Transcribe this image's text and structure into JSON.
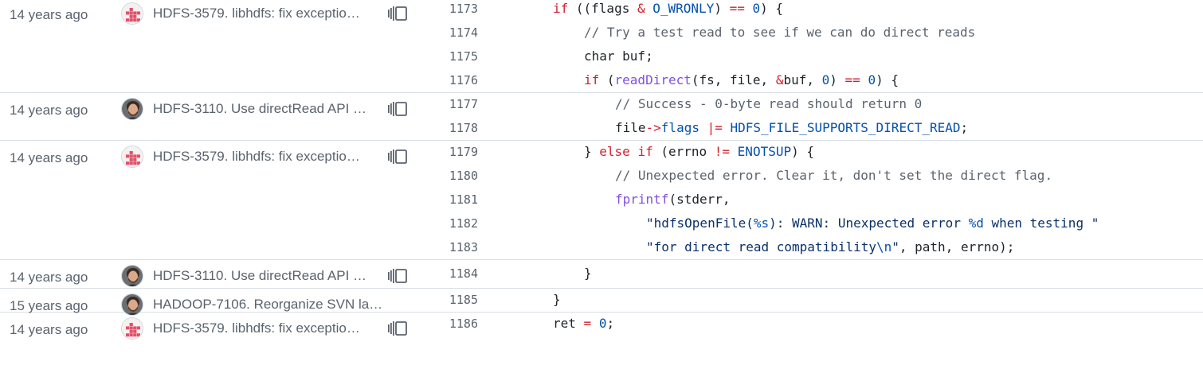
{
  "groups": [
    {
      "age": "14 years ago",
      "avatar": "checker",
      "message": "HDFS-3579. libhdfs: fix exceptio…",
      "reblame": true,
      "lines": [
        {
          "num": "1173",
          "indent": 0,
          "tokens": [
            {
              "t": "if",
              "c": "k"
            },
            {
              "t": " ((flags "
            },
            {
              "t": "&",
              "c": "k"
            },
            {
              "t": " "
            },
            {
              "t": "O_WRONLY",
              "c": "m"
            },
            {
              "t": ") "
            },
            {
              "t": "==",
              "c": "k"
            },
            {
              "t": " "
            },
            {
              "t": "0",
              "c": "m"
            },
            {
              "t": ") {"
            }
          ]
        },
        {
          "num": "1174",
          "indent": 1,
          "tokens": [
            {
              "t": "// Try a test read to see if we can do direct reads",
              "c": "c"
            }
          ]
        },
        {
          "num": "1175",
          "indent": 1,
          "tokens": [
            {
              "t": "char buf;"
            }
          ]
        },
        {
          "num": "1176",
          "indent": 1,
          "tokens": [
            {
              "t": "if",
              "c": "k"
            },
            {
              "t": " ("
            },
            {
              "t": "readDirect",
              "c": "f"
            },
            {
              "t": "(fs, file, "
            },
            {
              "t": "&",
              "c": "k"
            },
            {
              "t": "buf, "
            },
            {
              "t": "0",
              "c": "m"
            },
            {
              "t": ") "
            },
            {
              "t": "==",
              "c": "k"
            },
            {
              "t": " "
            },
            {
              "t": "0",
              "c": "m"
            },
            {
              "t": ") {"
            }
          ]
        }
      ]
    },
    {
      "age": "14 years ago",
      "avatar": "person",
      "message": "HDFS-3110. Use directRead API …",
      "reblame": true,
      "lines": [
        {
          "num": "1177",
          "indent": 2,
          "tokens": [
            {
              "t": "// Success - 0-byte read should return 0",
              "c": "c"
            }
          ]
        },
        {
          "num": "1178",
          "indent": 2,
          "tokens": [
            {
              "t": "file"
            },
            {
              "t": "->",
              "c": "k"
            },
            {
              "t": "flags",
              "c": "m"
            },
            {
              "t": " "
            },
            {
              "t": "|=",
              "c": "k"
            },
            {
              "t": " "
            },
            {
              "t": "HDFS_FILE_SUPPORTS_DIRECT_READ",
              "c": "m"
            },
            {
              "t": ";"
            }
          ]
        }
      ]
    },
    {
      "age": "14 years ago",
      "avatar": "checker",
      "message": "HDFS-3579. libhdfs: fix exceptio…",
      "reblame": true,
      "lines": [
        {
          "num": "1179",
          "indent": 1,
          "tokens": [
            {
              "t": "} "
            },
            {
              "t": "else",
              "c": "k"
            },
            {
              "t": " "
            },
            {
              "t": "if",
              "c": "k"
            },
            {
              "t": " (errno "
            },
            {
              "t": "!=",
              "c": "k"
            },
            {
              "t": " "
            },
            {
              "t": "ENOTSUP",
              "c": "m"
            },
            {
              "t": ") {"
            }
          ]
        },
        {
          "num": "1180",
          "indent": 2,
          "tokens": [
            {
              "t": "// Unexpected error. Clear it, don't set the direct flag.",
              "c": "c"
            }
          ]
        },
        {
          "num": "1181",
          "indent": 2,
          "tokens": [
            {
              "t": "fprintf",
              "c": "f"
            },
            {
              "t": "(stderr,"
            }
          ]
        },
        {
          "num": "1182",
          "indent": 3,
          "tokens": [
            {
              "t": "\"hdfsOpenFile(",
              "c": "s"
            },
            {
              "t": "%s",
              "c": "m"
            },
            {
              "t": "): WARN: Unexpected error ",
              "c": "s"
            },
            {
              "t": "%d",
              "c": "m"
            },
            {
              "t": " when testing \"",
              "c": "s"
            }
          ]
        },
        {
          "num": "1183",
          "indent": 3,
          "tokens": [
            {
              "t": "\"for direct read compatibility",
              "c": "s"
            },
            {
              "t": "\\n",
              "c": "m"
            },
            {
              "t": "\"",
              "c": "s"
            },
            {
              "t": ", path, errno);"
            }
          ]
        }
      ]
    },
    {
      "age": "14 years ago",
      "avatar": "person",
      "message": "HDFS-3110. Use directRead API …",
      "reblame": true,
      "lines": [
        {
          "num": "1184",
          "indent": 1,
          "tokens": [
            {
              "t": "}"
            }
          ]
        }
      ]
    },
    {
      "age": "15 years ago",
      "avatar": "person",
      "message": "HADOOP-7106. Reorganize SVN la…",
      "reblame": false,
      "lines": [
        {
          "num": "1185",
          "indent": 0,
          "tokens": [
            {
              "t": "}"
            }
          ]
        }
      ]
    },
    {
      "age": "14 years ago",
      "avatar": "checker",
      "message": "HDFS-3579. libhdfs: fix exceptio…",
      "reblame": true,
      "lines": [
        {
          "num": "1186",
          "indent": 0,
          "tokens": [
            {
              "t": "ret "
            },
            {
              "t": "=",
              "c": "k"
            },
            {
              "t": " "
            },
            {
              "t": "0",
              "c": "m"
            },
            {
              "t": ";"
            }
          ]
        }
      ]
    }
  ]
}
